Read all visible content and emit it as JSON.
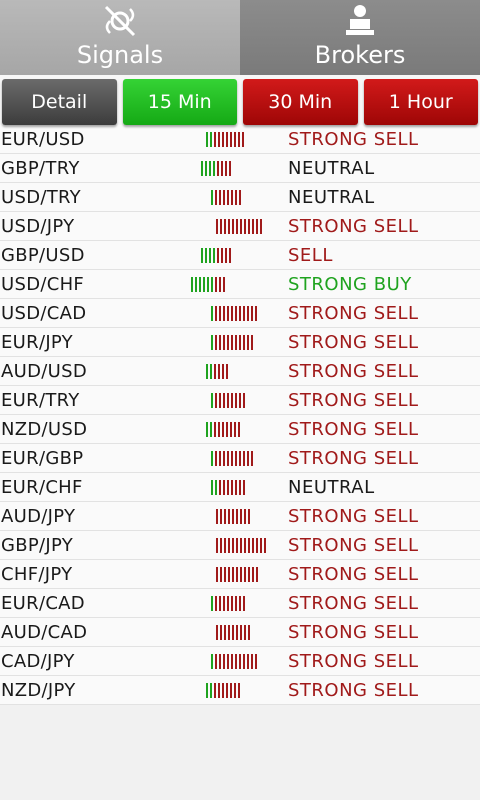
{
  "colors": {
    "sell": "#a01a1a",
    "buy": "#1fa31f",
    "neutral": "#1a1a1a"
  },
  "tabs": [
    {
      "label": "Signals",
      "icon": "satellite-icon"
    },
    {
      "label": "Brokers",
      "icon": "broker-desk-icon"
    }
  ],
  "buttons": [
    {
      "label": "Detail"
    },
    {
      "label": "15 Min"
    },
    {
      "label": "30 Min"
    },
    {
      "label": "1 Hour"
    }
  ],
  "rows": [
    {
      "pair": "EUR/USD",
      "signal": "STRONG SELL",
      "bars": {
        "green": 2,
        "red": 8
      }
    },
    {
      "pair": "GBP/TRY",
      "signal": "NEUTRAL",
      "bars": {
        "green": 4,
        "red": 4
      }
    },
    {
      "pair": "USD/TRY",
      "signal": "NEUTRAL",
      "bars": {
        "green": 1,
        "red": 7
      }
    },
    {
      "pair": "USD/JPY",
      "signal": "STRONG SELL",
      "bars": {
        "green": 0,
        "red": 12
      }
    },
    {
      "pair": "GBP/USD",
      "signal": "SELL",
      "bars": {
        "green": 4,
        "red": 4
      }
    },
    {
      "pair": "USD/CHF",
      "signal": "STRONG BUY",
      "bars": {
        "green": 6,
        "red": 3
      }
    },
    {
      "pair": "USD/CAD",
      "signal": "STRONG SELL",
      "bars": {
        "green": 1,
        "red": 11
      }
    },
    {
      "pair": "EUR/JPY",
      "signal": "STRONG SELL",
      "bars": {
        "green": 1,
        "red": 10
      }
    },
    {
      "pair": "AUD/USD",
      "signal": "STRONG SELL",
      "bars": {
        "green": 2,
        "red": 4
      }
    },
    {
      "pair": "EUR/TRY",
      "signal": "STRONG SELL",
      "bars": {
        "green": 1,
        "red": 8
      }
    },
    {
      "pair": "NZD/USD",
      "signal": "STRONG SELL",
      "bars": {
        "green": 2,
        "red": 7
      }
    },
    {
      "pair": "EUR/GBP",
      "signal": "STRONG SELL",
      "bars": {
        "green": 1,
        "red": 10
      }
    },
    {
      "pair": "EUR/CHF",
      "signal": "NEUTRAL",
      "bars": {
        "green": 2,
        "red": 7
      }
    },
    {
      "pair": "AUD/JPY",
      "signal": "STRONG SELL",
      "bars": {
        "green": 0,
        "red": 9
      }
    },
    {
      "pair": "GBP/JPY",
      "signal": "STRONG SELL",
      "bars": {
        "green": 0,
        "red": 13
      }
    },
    {
      "pair": "CHF/JPY",
      "signal": "STRONG SELL",
      "bars": {
        "green": 0,
        "red": 11
      }
    },
    {
      "pair": "EUR/CAD",
      "signal": "STRONG SELL",
      "bars": {
        "green": 1,
        "red": 8
      }
    },
    {
      "pair": "AUD/CAD",
      "signal": "STRONG SELL",
      "bars": {
        "green": 0,
        "red": 9
      }
    },
    {
      "pair": "CAD/JPY",
      "signal": "STRONG SELL",
      "bars": {
        "green": 1,
        "red": 11
      }
    },
    {
      "pair": "NZD/JPY",
      "signal": "STRONG SELL",
      "bars": {
        "green": 2,
        "red": 7
      }
    }
  ]
}
